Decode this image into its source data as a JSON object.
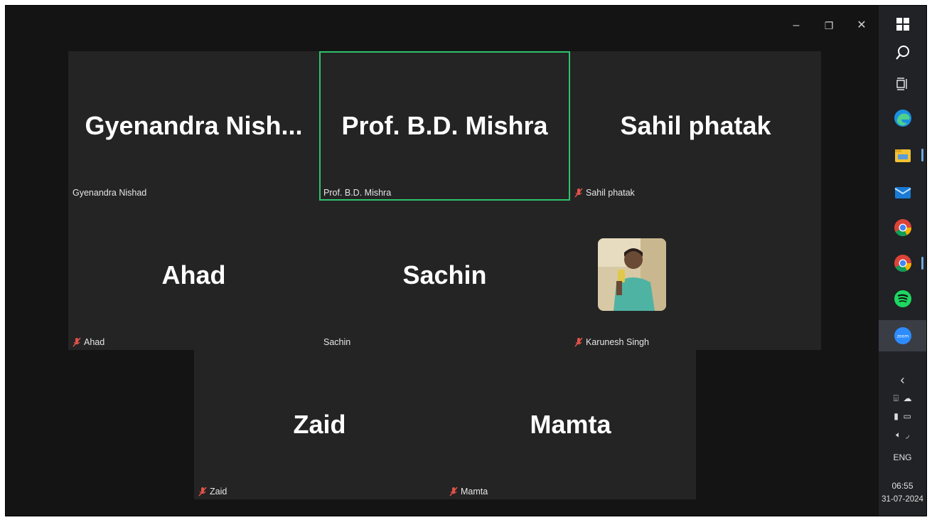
{
  "window": {
    "controls": {
      "minimize": "–",
      "restore": "❐",
      "close": "✕"
    }
  },
  "tiles": [
    {
      "name": "Gyenandra  Nish...",
      "label": "Gyenandra Nishad",
      "muted": false,
      "active": false
    },
    {
      "name": "Prof. B.D. Mishra",
      "label": "Prof. B.D. Mishra",
      "muted": false,
      "active": true
    },
    {
      "name": "Sahil phatak",
      "label": "Sahil phatak",
      "muted": true,
      "active": false
    },
    {
      "name": "Ahad",
      "label": "Ahad",
      "muted": true,
      "active": false
    },
    {
      "name": "Sachin",
      "label": "Sachin",
      "muted": false,
      "active": false
    },
    {
      "name": "",
      "label": "Karunesh Singh",
      "muted": true,
      "active": false,
      "has_photo": true
    },
    {
      "name": "Zaid",
      "label": "Zaid",
      "muted": true,
      "active": false
    },
    {
      "name": "Mamta",
      "label": "Mamta",
      "muted": true,
      "active": false
    }
  ],
  "taskbar": {
    "icons": [
      "windows-start-icon",
      "search-icon",
      "task-view-icon",
      "edge-icon",
      "file-explorer-icon",
      "mail-icon",
      "chrome-icon",
      "chrome-icon",
      "spotify-icon",
      "zoom-icon"
    ],
    "zoom_icon_text": "zoom",
    "tray": {
      "chevron": "‹",
      "language": "ENG",
      "time": "06:55",
      "date": "31-07-2024"
    }
  },
  "colors": {
    "active_border": "#2cc36b",
    "tile_bg": "#242424",
    "muted_mic": "#e0524a"
  }
}
